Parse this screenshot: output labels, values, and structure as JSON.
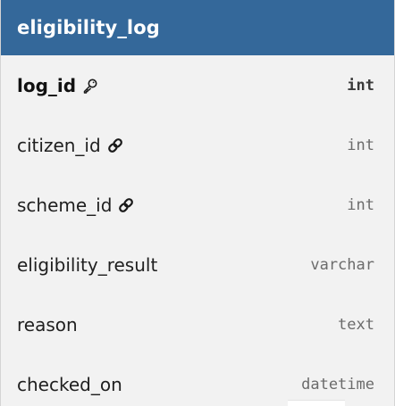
{
  "table": {
    "name": "eligibility_log",
    "header_color": "#34689a",
    "columns": [
      {
        "name": "log_id",
        "type": "int",
        "key": "primary",
        "icon": "key-icon"
      },
      {
        "name": "citizen_id",
        "type": "int",
        "key": "foreign",
        "icon": "link-icon"
      },
      {
        "name": "scheme_id",
        "type": "int",
        "key": "foreign",
        "icon": "link-icon"
      },
      {
        "name": "eligibility_result",
        "type": "varchar",
        "key": "none"
      },
      {
        "name": "reason",
        "type": "text",
        "key": "none"
      },
      {
        "name": "checked_on",
        "type": "datetime",
        "key": "none"
      }
    ]
  }
}
